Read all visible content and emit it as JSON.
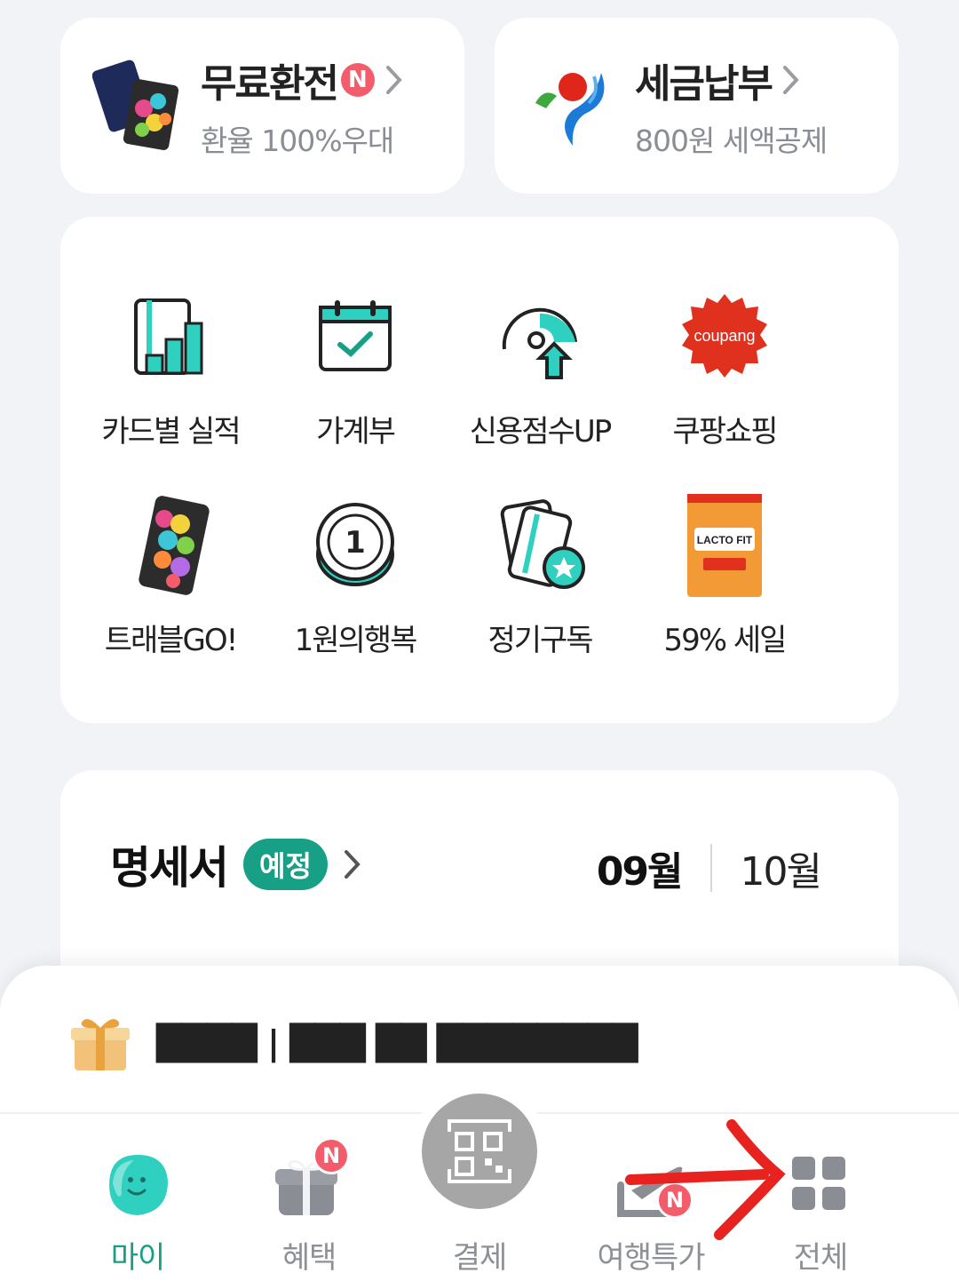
{
  "promos": [
    {
      "title": "무료환전",
      "badge": "N",
      "sub": "환율 100%우대",
      "icon": "travel-card-icon"
    },
    {
      "title": "세금납부",
      "sub": "800원 세액공제",
      "icon": "seoul-logo-icon"
    }
  ],
  "menu": [
    {
      "label": "카드별 실적",
      "icon": "bar-chart-icon"
    },
    {
      "label": "가계부",
      "icon": "calendar-check-icon"
    },
    {
      "label": "신용점수UP",
      "icon": "credit-gauge-icon"
    },
    {
      "label": "쿠팡쇼핑",
      "icon": "coupang-logo-icon",
      "logo_text": "coupang"
    },
    {
      "label": "트래블GO!",
      "icon": "travel-go-card-icon"
    },
    {
      "label": "1원의행복",
      "icon": "coin-icon",
      "coin_text": "1"
    },
    {
      "label": "정기구독",
      "icon": "subscription-cards-icon"
    },
    {
      "label": "59% 세일",
      "icon": "lactofit-product-icon",
      "product_text": "LACTO FIT"
    }
  ],
  "statement": {
    "title": "명세서",
    "tag": "예정",
    "months": [
      "09월",
      "10월"
    ],
    "active_month": "09월"
  },
  "notice": {
    "text": "████ | ███ ██ ████████",
    "icon": "gift-icon"
  },
  "tabs": [
    {
      "label": "마이",
      "icon": "my-face-icon",
      "active": true
    },
    {
      "label": "혜택",
      "icon": "benefit-gift-icon",
      "badge": "N"
    },
    {
      "label": "결제",
      "icon": "qr-pay-icon"
    },
    {
      "label": "여행특가",
      "icon": "plane-icon",
      "badge": "N"
    },
    {
      "label": "전체",
      "icon": "grid-menu-icon"
    }
  ],
  "colors": {
    "accent": "#18a087",
    "badge": "#f25c6b",
    "coupang": "#e0301e",
    "background": "#f2f3f7"
  }
}
